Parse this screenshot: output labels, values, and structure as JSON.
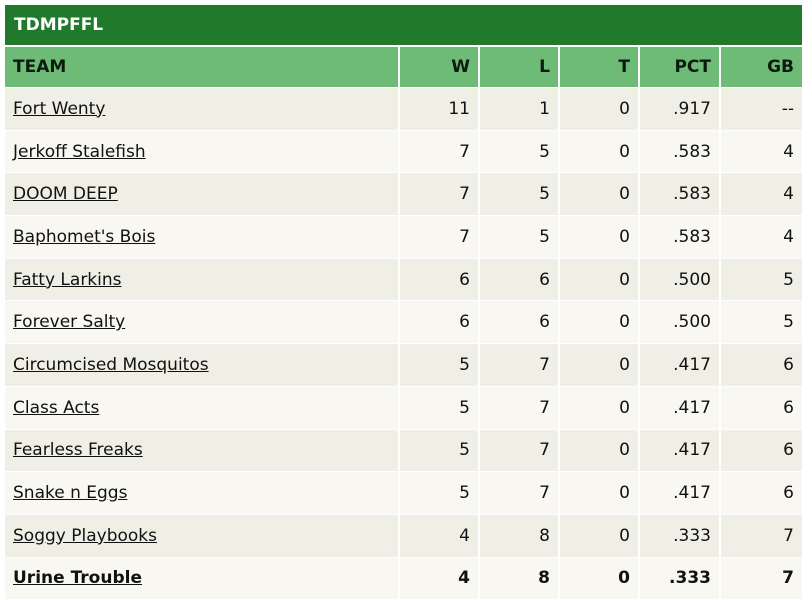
{
  "league": {
    "name": "TDMPFFL"
  },
  "columns": [
    "TEAM",
    "W",
    "L",
    "T",
    "PCT",
    "GB"
  ],
  "rows": [
    {
      "team": "Fort Wenty",
      "w": "11",
      "l": "1",
      "t": "0",
      "pct": ".917",
      "gb": "--"
    },
    {
      "team": "Jerkoff Stalefish",
      "w": "7",
      "l": "5",
      "t": "0",
      "pct": ".583",
      "gb": "4"
    },
    {
      "team": "DOOM DEEP",
      "w": "7",
      "l": "5",
      "t": "0",
      "pct": ".583",
      "gb": "4"
    },
    {
      "team": "Baphomet's Bois",
      "w": "7",
      "l": "5",
      "t": "0",
      "pct": ".583",
      "gb": "4"
    },
    {
      "team": "Fatty Larkins",
      "w": "6",
      "l": "6",
      "t": "0",
      "pct": ".500",
      "gb": "5"
    },
    {
      "team": "Forever Salty",
      "w": "6",
      "l": "6",
      "t": "0",
      "pct": ".500",
      "gb": "5"
    },
    {
      "team": "Circumcised Mosquitos",
      "w": "5",
      "l": "7",
      "t": "0",
      "pct": ".417",
      "gb": "6"
    },
    {
      "team": "Class Acts",
      "w": "5",
      "l": "7",
      "t": "0",
      "pct": ".417",
      "gb": "6"
    },
    {
      "team": "Fearless Freaks",
      "w": "5",
      "l": "7",
      "t": "0",
      "pct": ".417",
      "gb": "6"
    },
    {
      "team": "Snake n Eggs",
      "w": "5",
      "l": "7",
      "t": "0",
      "pct": ".417",
      "gb": "6"
    },
    {
      "team": "Soggy Playbooks",
      "w": "4",
      "l": "8",
      "t": "0",
      "pct": ".333",
      "gb": "7"
    },
    {
      "team": "Urine Trouble",
      "w": "4",
      "l": "8",
      "t": "0",
      "pct": ".333",
      "gb": "7",
      "highlight": true
    }
  ],
  "colors": {
    "header_bar": "#217a2c",
    "column_header": "#6dbb77",
    "row_odd": "#f0efe6",
    "row_even": "#f8f7f1"
  }
}
